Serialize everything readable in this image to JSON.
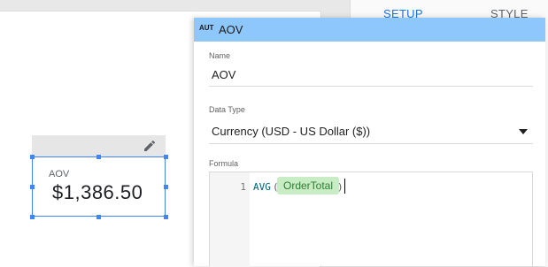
{
  "tabs": {
    "setup": "SETUP",
    "style": "STYLE"
  },
  "scorecard": {
    "label": "AOV",
    "value": "$1,386.50"
  },
  "dialog": {
    "badge": "AUT",
    "title": "AOV",
    "name_label": "Name",
    "name_value": "AOV",
    "datatype_label": "Data Type",
    "datatype_value": "Currency (USD - US Dollar ($))",
    "formula_label": "Formula",
    "formula": {
      "line_number": "1",
      "function": "AVG",
      "open_paren": "(",
      "field_chip": "OrderTotal",
      "close_paren": ")"
    }
  },
  "icons": {
    "edit": "pencil-icon",
    "dropdown": "caret-down-icon"
  },
  "colors": {
    "header": "#8ec7fb",
    "selection": "#4285f4",
    "chip_bg": "#c8ecc4",
    "tab_active": "#1a73e8"
  }
}
